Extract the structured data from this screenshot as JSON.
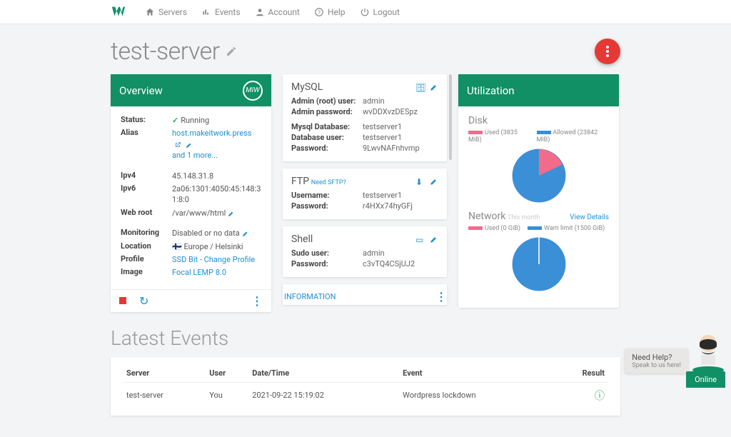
{
  "nav": {
    "servers": "Servers",
    "events": "Events",
    "account": "Account",
    "help": "Help",
    "logout": "Logout"
  },
  "page": {
    "title": "test-server"
  },
  "overview": {
    "header": "Overview",
    "badge": "MiW",
    "status_label": "Status:",
    "status_value": "Running",
    "alias_label": "Alias",
    "alias_value": "host.makeitwork.press",
    "alias_more": "and 1 more...",
    "ipv4_label": "Ipv4",
    "ipv4_value": "45.148.31.8",
    "ipv6_label": "Ipv6",
    "ipv6_value": "2a06:1301:4050:45:148:31:8:0",
    "webroot_label": "Web root",
    "webroot_value": "/var/www/html",
    "monitoring_label": "Monitoring",
    "monitoring_value": "Disabled or no data",
    "location_label": "Location",
    "location_value": "Europe / Helsinki",
    "profile_label": "Profile",
    "profile_value": "SSD Bit - Change Profile",
    "image_label": "Image",
    "image_value": "Focal LEMP 8.0"
  },
  "mysql": {
    "title": "MySQL",
    "admin_user_label": "Admin (root) user:",
    "admin_user": "admin",
    "admin_pass_label": "Admin password:",
    "admin_pass": "wvDDXvzDESpz",
    "db_label": "Mysql Database:",
    "db": "testserver1",
    "dbuser_label": "Database user:",
    "dbuser": "testserver1",
    "pass_label": "Password:",
    "pass": "9LwvNAFnhvmp"
  },
  "ftp": {
    "title": "FTP",
    "note": "Need SFTP?",
    "user_label": "Username:",
    "user": "testserver1",
    "pass_label": "Password:",
    "pass": "r4HXx74hyGFj"
  },
  "shell": {
    "title": "Shell",
    "user_label": "Sudo user:",
    "user": "admin",
    "pass_label": "Password:",
    "pass": "c3vTQ4CSjUJ2"
  },
  "info_link": "INFORMATION",
  "util": {
    "header": "Utilization",
    "disk_title": "Disk",
    "disk_used": "Used (3835 MiB)",
    "disk_allowed": "Allowed (23842 MiB)",
    "net_title": "Network",
    "net_period": "This month",
    "view_details": "View Details",
    "net_used": "Used (0 GiB)",
    "net_warn": "Warn limit (1500 GiB)"
  },
  "chart_data": [
    {
      "type": "pie",
      "title": "Disk",
      "series": [
        {
          "name": "Used (3835 MiB)",
          "value": 3835,
          "color": "#f36b8b"
        },
        {
          "name": "Allowed (23842 MiB)",
          "value": 23842,
          "color": "#3b8fd6"
        }
      ]
    },
    {
      "type": "pie",
      "title": "Network This month",
      "series": [
        {
          "name": "Used (0 GiB)",
          "value": 0,
          "color": "#f36b8b"
        },
        {
          "name": "Warn limit (1500 GiB)",
          "value": 1500,
          "color": "#3b8fd6"
        }
      ]
    }
  ],
  "events": {
    "title": "Latest Events",
    "columns": {
      "server": "Server",
      "user": "User",
      "datetime": "Date/Time",
      "event": "Event",
      "result": "Result"
    },
    "rows": [
      {
        "server": "test-server",
        "user": "You",
        "datetime": "2021-09-22 15:19:02",
        "event": "Wordpress lockdown"
      }
    ]
  },
  "help": {
    "title": "Need Help?",
    "sub": "Speak to us here!",
    "status": "Online"
  },
  "colors": {
    "brand": "#118f65",
    "link": "#1c90d4",
    "used": "#f36b8b",
    "allowed": "#3b8fd6",
    "danger": "#e53935"
  }
}
